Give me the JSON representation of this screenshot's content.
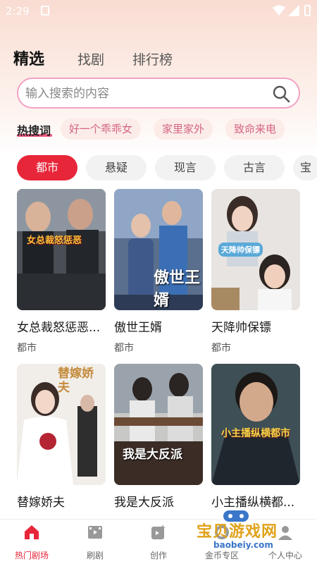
{
  "status": {
    "time": "2:29"
  },
  "tabs": [
    {
      "label": "精选",
      "active": true
    },
    {
      "label": "找剧",
      "active": false
    },
    {
      "label": "排行榜",
      "active": false
    }
  ],
  "search": {
    "placeholder": "输入搜索的内容"
  },
  "hot_search": {
    "label": "热搜词",
    "chips": [
      "好一个乖乖女",
      "家里家外",
      "致命来电"
    ]
  },
  "categories": [
    {
      "label": "都市",
      "active": true
    },
    {
      "label": "悬疑",
      "active": false
    },
    {
      "label": "现言",
      "active": false
    },
    {
      "label": "古言",
      "active": false
    },
    {
      "label": "宝",
      "active": false
    }
  ],
  "dramas": [
    {
      "title": "女总裁怒惩恶...",
      "genre": "都市",
      "poster_text": "女总裁怒惩恶"
    },
    {
      "title": "傲世王婿",
      "genre": "都市",
      "poster_text": "傲世王婿"
    },
    {
      "title": "天降帅保镖",
      "genre": "都市",
      "poster_text": "天降帅保镖"
    },
    {
      "title": "替嫁娇夫",
      "genre": "",
      "poster_text": "替嫁娇夫"
    },
    {
      "title": "我是大反派",
      "genre": "",
      "poster_text": "我是大反派"
    },
    {
      "title": "小主播纵横都...",
      "genre": "",
      "poster_text": "小主播纵横都市"
    }
  ],
  "bottom_nav": [
    {
      "label": "热门剧场",
      "icon": "home-icon",
      "active": true
    },
    {
      "label": "刷剧",
      "icon": "film-icon",
      "active": false
    },
    {
      "label": "创作",
      "icon": "create-icon",
      "active": false
    },
    {
      "label": "金币专区",
      "icon": "coin-icon",
      "active": false
    },
    {
      "label": "个人中心",
      "icon": "user-icon",
      "active": false
    }
  ],
  "watermark": {
    "text": "宝贝游戏网",
    "url": "baobeiy.com"
  },
  "colors": {
    "accent": "#e8263a",
    "search_border": "#f3a2c4",
    "chip_text": "#d46580"
  }
}
